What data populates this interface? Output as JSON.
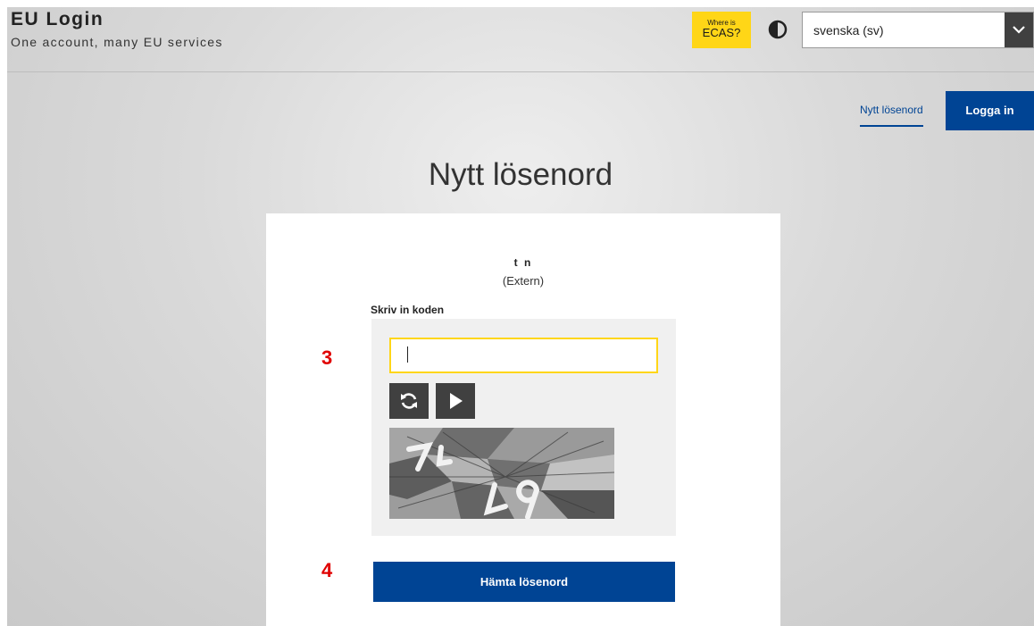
{
  "header": {
    "title": "EU Login",
    "subtitle": "One account, many EU services",
    "ecas_line1": "Where is",
    "ecas_line2": "ECAS?",
    "contrast_icon": "contrast-icon",
    "language": "svenska (sv)"
  },
  "nav": {
    "new_password_link": "Nytt lösenord",
    "login_button": "Logga in"
  },
  "page": {
    "title": "Nytt lösenord",
    "user_name": "t n",
    "user_type": "(Extern)",
    "captcha_label": "Skriv in koden",
    "captcha_input_value": "",
    "refresh_icon": "refresh-icon",
    "play_icon": "play-icon",
    "submit_button": "Hämta lösenord"
  },
  "annotations": {
    "marker_3": "3",
    "marker_4": "4"
  },
  "colors": {
    "primary": "#004494",
    "ecas_yellow": "#ffd617",
    "marker_red": "#e00000"
  }
}
